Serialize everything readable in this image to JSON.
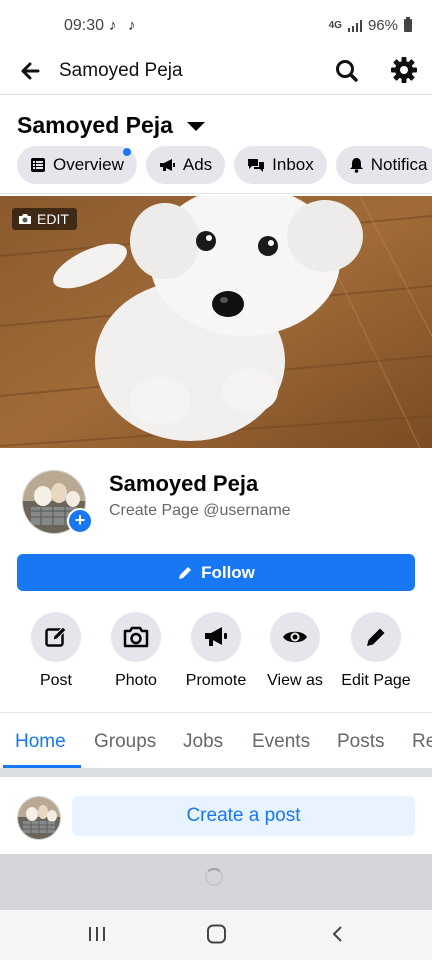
{
  "status_bar": {
    "time": "09:30",
    "notification_icons": [
      "tiktok-icon",
      "tiktok-icon"
    ],
    "network": "4G",
    "battery": "96%"
  },
  "app_bar": {
    "title": "Samoyed Peja",
    "icons": [
      "back-arrow-icon",
      "search-icon",
      "gear-icon"
    ]
  },
  "page_header": {
    "name": "Samoyed Peja",
    "chips": [
      {
        "label": "Overview",
        "icon": "overview-icon",
        "badge_dot": true
      },
      {
        "label": "Ads",
        "icon": "megaphone-icon"
      },
      {
        "label": "Inbox",
        "icon": "chat-icon"
      },
      {
        "label": "Notifica",
        "icon": "bell-icon"
      }
    ]
  },
  "cover": {
    "edit_label": "EDIT"
  },
  "profile": {
    "name": "Samoyed Peja",
    "subtitle": "Create Page @username"
  },
  "follow_button": {
    "label": "Follow"
  },
  "actions": [
    {
      "label": "Post",
      "icon": "compose-icon"
    },
    {
      "label": "Photo",
      "icon": "camera-icon"
    },
    {
      "label": "Promote",
      "icon": "megaphone-icon"
    },
    {
      "label": "View as",
      "icon": "eye-icon"
    },
    {
      "label": "Edit Page",
      "icon": "pencil-icon"
    }
  ],
  "tabs": [
    {
      "label": "Home",
      "active": true
    },
    {
      "label": "Groups"
    },
    {
      "label": "Jobs"
    },
    {
      "label": "Events"
    },
    {
      "label": "Posts"
    },
    {
      "label": "Re"
    }
  ],
  "composer": {
    "label": "Create a post"
  },
  "colors": {
    "accent": "#1877f2",
    "chip_bg": "#e4e6eb",
    "composer_bg": "#e7f3ff"
  }
}
